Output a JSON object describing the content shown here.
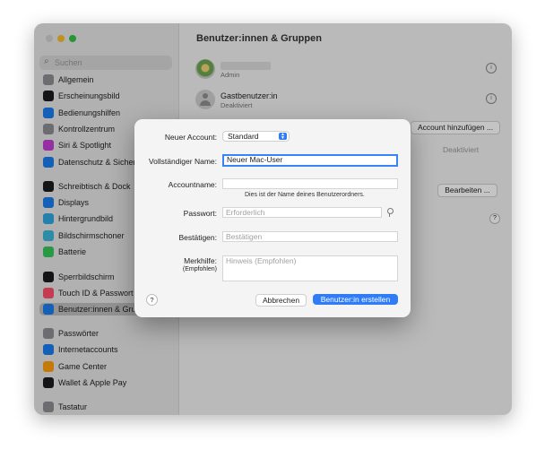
{
  "window": {
    "title": "Benutzer:innen & Gruppen",
    "search_placeholder": "Suchen"
  },
  "sidebar": {
    "items": [
      {
        "label": "Allgemein",
        "icon": "gear-icon",
        "color": "#8e8e93"
      },
      {
        "label": "Erscheinungsbild",
        "icon": "appearance-icon",
        "color": "#1c1c1e"
      },
      {
        "label": "Bedienungshilfen",
        "icon": "accessibility-icon",
        "color": "#1a7cf0"
      },
      {
        "label": "Kontrollzentrum",
        "icon": "control-center-icon",
        "color": "#8e8e93"
      },
      {
        "label": "Siri & Spotlight",
        "icon": "siri-icon",
        "color": "#c23fd4"
      },
      {
        "label": "Datenschutz & Sicherheit",
        "icon": "hand-icon",
        "color": "#1a7cf0"
      },
      {
        "label": "Schreibtisch & Dock",
        "icon": "dock-icon",
        "color": "#1c1c1e"
      },
      {
        "label": "Displays",
        "icon": "display-icon",
        "color": "#1a7cf0"
      },
      {
        "label": "Hintergrundbild",
        "icon": "wallpaper-icon",
        "color": "#2fa7e0"
      },
      {
        "label": "Bildschirmschoner",
        "icon": "screensaver-icon",
        "color": "#38b6d8"
      },
      {
        "label": "Batterie",
        "icon": "battery-icon",
        "color": "#34c759"
      },
      {
        "label": "Sperrbildschirm",
        "icon": "lock-screen-icon",
        "color": "#1c1c1e"
      },
      {
        "label": "Touch ID & Passwort",
        "icon": "fingerprint-icon",
        "color": "#ff4f6a"
      },
      {
        "label": "Benutzer:innen & Gruppen",
        "icon": "users-icon",
        "color": "#1a7cf0"
      },
      {
        "label": "Passwörter",
        "icon": "key-icon",
        "color": "#8e8e93"
      },
      {
        "label": "Internetaccounts",
        "icon": "at-icon",
        "color": "#1a7cf0"
      },
      {
        "label": "Game Center",
        "icon": "game-center-icon",
        "color": "#ff9f0a"
      },
      {
        "label": "Wallet & Apple Pay",
        "icon": "wallet-icon",
        "color": "#1c1c1e"
      },
      {
        "label": "Tastatur",
        "icon": "keyboard-icon",
        "color": "#8e8e93"
      }
    ]
  },
  "main": {
    "admin_role": "Admin",
    "guest_name": "Gastbenutzer:in",
    "guest_status": "Deaktiviert",
    "add_account_button": "Account hinzufügen ...",
    "autologin_value": "Deaktiviert",
    "edit_button": "Bearbeiten ...",
    "help_label": "?"
  },
  "dialog": {
    "new_account_label": "Neuer Account:",
    "new_account_value": "Standard",
    "full_name_label": "Vollständiger Name:",
    "full_name_value": "Neuer Mac-User",
    "account_name_label": "Accountname:",
    "account_name_value": "",
    "account_name_hint": "Dies ist der Name deines Benutzerordners.",
    "password_label": "Passwort:",
    "password_placeholder": "Erforderlich",
    "verify_label": "Bestätigen:",
    "verify_placeholder": "Bestätigen",
    "hint_label": "Merkhilfe:",
    "hint_sublabel": "(Empfohlen)",
    "hint_placeholder": "Hinweis (Empfohlen)",
    "help_label": "?",
    "cancel_button": "Abbrechen",
    "create_button": "Benutzer:in erstellen",
    "accent_color": "#2f7cf6"
  }
}
